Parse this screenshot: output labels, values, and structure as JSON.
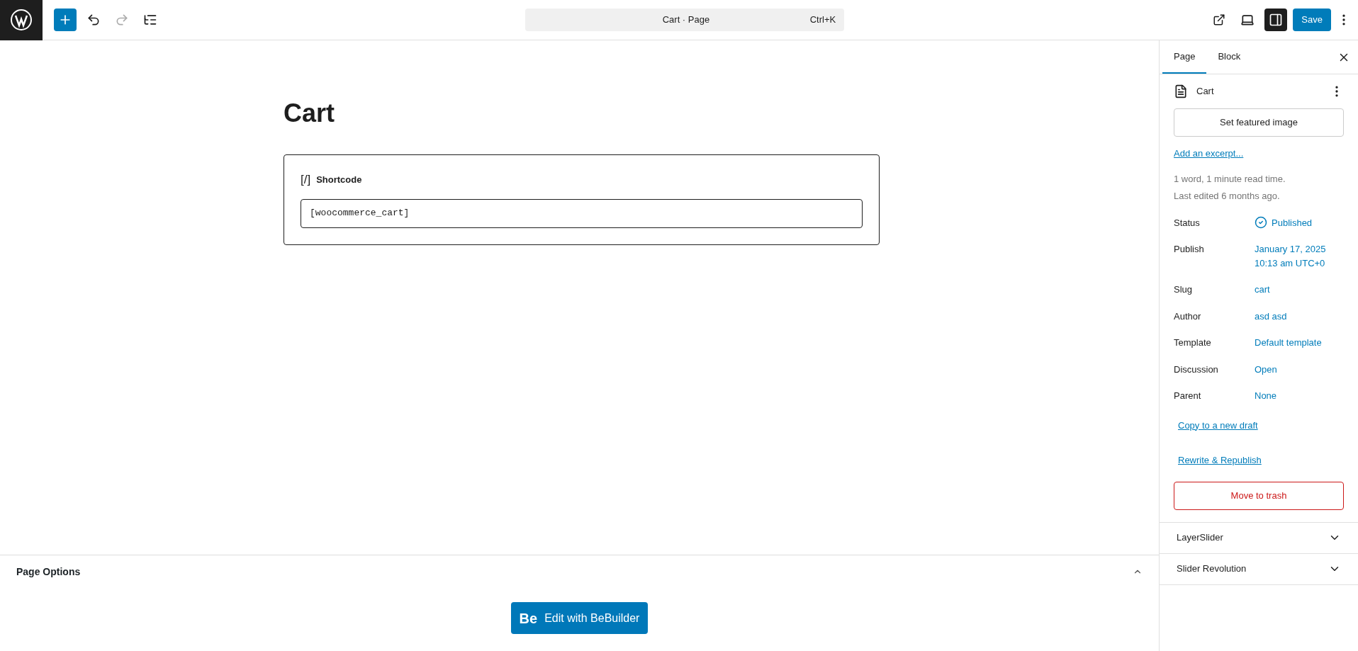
{
  "toolbar": {
    "command_bar": {
      "title": "Cart · Page",
      "shortcut": "Ctrl+K"
    },
    "sidebar_toggle": {
      "selected": true
    },
    "save": "Save"
  },
  "editor": {
    "title": "Cart",
    "block": {
      "label": "Shortcode",
      "icon_text": "[/]",
      "value": "[woocommerce_cart]"
    }
  },
  "page_options": {
    "title": "Page Options",
    "expanded": true,
    "button": {
      "logo": "Be",
      "label": "Edit with BeBuilder"
    }
  },
  "sidebar": {
    "tabs": [
      {
        "label": "Page",
        "selected": true
      },
      {
        "label": "Block",
        "selected": false
      }
    ],
    "page_title": "Cart",
    "featured_image": "Set featured image",
    "excerpt_link": "Add an excerpt...",
    "meta": [
      "1 word, 1 minute read time.",
      "Last edited 6 months ago."
    ],
    "fields": [
      {
        "label": "Status",
        "kind": "status",
        "value": [
          "Published"
        ]
      },
      {
        "label": "Publish",
        "kind": "link",
        "value": [
          "January 17, 2025",
          "10:13 am UTC+0"
        ]
      },
      {
        "label": "Slug",
        "kind": "link",
        "value": [
          "cart"
        ]
      },
      {
        "label": "Author",
        "kind": "link",
        "value": [
          "asd asd"
        ]
      },
      {
        "label": "Template",
        "kind": "link",
        "value": [
          "Default template"
        ]
      },
      {
        "label": "Discussion",
        "kind": "link",
        "value": [
          "Open"
        ]
      },
      {
        "label": "Parent",
        "kind": "link",
        "value": [
          "None"
        ]
      }
    ],
    "links": [
      "Copy to a new draft",
      "Rewrite & Republish"
    ],
    "trash": "Move to trash",
    "panels": [
      {
        "title": "LayerSlider",
        "expanded": false
      },
      {
        "title": "Slider Revolution",
        "expanded": false
      }
    ]
  }
}
